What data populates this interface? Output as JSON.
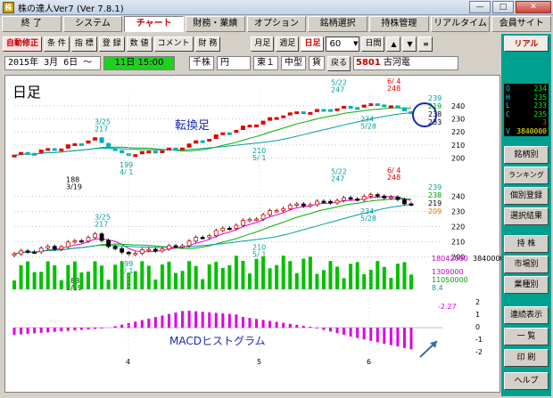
{
  "window": {
    "title": "株の達人Ver7 (Ver 7.8.1)",
    "minimize": "—",
    "maximize": "□",
    "close": "✕"
  },
  "menu": [
    {
      "label": "終 了"
    },
    {
      "label": "システム"
    },
    {
      "label": "チャート"
    },
    {
      "label": "財務・業績"
    },
    {
      "label": "オプション"
    },
    {
      "label": "銘柄選択"
    },
    {
      "label": "持株管理"
    },
    {
      "label": "リアルタイム"
    },
    {
      "label": "会員サイト"
    }
  ],
  "toolbar": {
    "left": [
      "自動修正",
      "条 件",
      "指 標",
      "登 録",
      "数 値",
      "コメント",
      "財 務"
    ],
    "period": [
      "月足",
      "週足",
      "日足"
    ],
    "period_active": "日足",
    "count": "60",
    "day_range": "日間",
    "up": "▲",
    "down": "▼",
    "menu": "≡"
  },
  "info": {
    "date": "2015年 3月 6日 〜",
    "time": "11日 15:00",
    "unit_label": "千株",
    "currency": "円",
    "market": "東１",
    "size": "中型",
    "sector": "貨",
    "back": "戻る",
    "code": "5801",
    "name": "古河電"
  },
  "chart": {
    "period_label": "日足",
    "annotation_top": "転換足",
    "annotation_bottom": "MACDヒストグラム",
    "x_labels": [
      "4",
      "5",
      "6"
    ],
    "upper": {
      "y_ticks": [
        "240",
        "230",
        "220",
        "210",
        "200"
      ],
      "legend": [
        "239",
        "219",
        "238",
        "233"
      ],
      "marks": [
        {
          "date": "3/25",
          "price": "217"
        },
        {
          "date": "5/22",
          "price": "247"
        },
        {
          "date": "6/ 4",
          "price": "248"
        },
        {
          "date": "3/19",
          "price": "188"
        },
        {
          "date": "4/ 1",
          "price": "199"
        },
        {
          "date": "5/ 1",
          "price": "210"
        },
        {
          "date": "5/28",
          "price": "234"
        }
      ]
    },
    "middle": {
      "y_ticks": [
        "240",
        "230",
        "220",
        "210",
        "200"
      ],
      "legend": [
        "239",
        "238",
        "219",
        "209"
      ],
      "marks": [
        {
          "date": "3/25",
          "price": "217"
        },
        {
          "date": "5/22",
          "price": "247"
        },
        {
          "date": "6/ 4",
          "price": "248"
        },
        {
          "date": "3/19",
          "price": "188"
        },
        {
          "date": "4/ 1",
          "price": "199"
        },
        {
          "date": "5/ 1",
          "price": "210"
        },
        {
          "date": "5/28",
          "price": "234"
        }
      ]
    },
    "volume": {
      "max": "18042000",
      "right": "3840000",
      "mid": "1309000",
      "low": "11050000",
      "ratio": "8.4"
    },
    "macd": {
      "current": "-2.27",
      "y_ticks": [
        "2",
        "1",
        "0",
        "-1",
        "-2"
      ],
      "x_labels": [
        "4",
        "5",
        "6"
      ]
    },
    "colors": {
      "up": "#e00000",
      "down": "#00b0b0",
      "ma_short": "#e000e0",
      "ma_mid": "#00b000",
      "ma_long": "#00a0a0",
      "volume": "#00c000",
      "macd": "#e000e0"
    }
  },
  "quote": [
    {
      "key": "O",
      "value": "234"
    },
    {
      "key": "H",
      "value": "235"
    },
    {
      "key": "L",
      "value": "233"
    },
    {
      "key": "C",
      "value": "235"
    },
    {
      "key": "",
      "value": "3"
    },
    {
      "key": "V",
      "value": "3840000"
    }
  ],
  "right_panel": {
    "top": "リアル",
    "buttons": [
      "銘柄別",
      "ランキング",
      "個別登録",
      "選択結果",
      "持 株",
      "市場別",
      "業種別"
    ],
    "bottom": [
      "連続表示",
      "一 覧",
      "印 刷",
      "ヘルプ"
    ]
  },
  "chart_data": {
    "type": "candlestick",
    "period_label": "日足",
    "x_labels": [
      "4",
      "5",
      "6"
    ],
    "price_y_ticks": [
      240,
      230,
      220,
      210,
      200
    ],
    "price_ylim": [
      200,
      245
    ],
    "annotations": [
      {
        "date": "3/19",
        "value": 188
      },
      {
        "date": "3/25",
        "value": 217
      },
      {
        "date": "4/ 1",
        "value": 199
      },
      {
        "date": "5/ 1",
        "value": 210
      },
      {
        "date": "5/22",
        "value": 247
      },
      {
        "date": "5/28",
        "value": 234
      },
      {
        "date": "6/ 4",
        "value": 248
      }
    ],
    "macd_current": -2.27,
    "macd_ylim": [
      -2,
      2
    ]
  }
}
